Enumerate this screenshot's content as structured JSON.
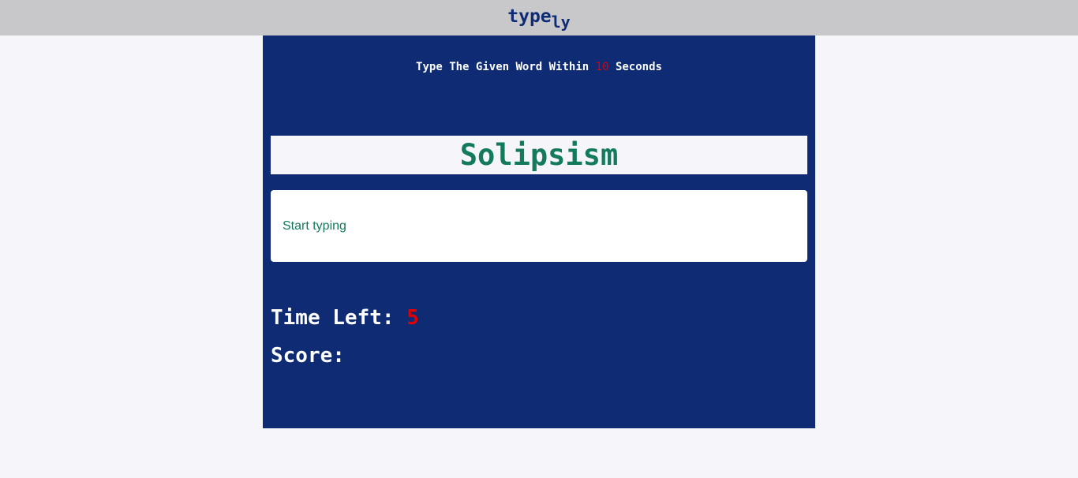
{
  "header": {
    "logo_main": "type",
    "logo_sub": "ly"
  },
  "game": {
    "instruction_prefix": "Type The Given Word Within",
    "instruction_seconds": "10",
    "instruction_suffix": "Seconds",
    "current_word": "Solipsism",
    "input": {
      "value": "",
      "placeholder": "Start typing"
    },
    "time_left_label": "Time Left:",
    "time_left_value": "5",
    "score_label": "Score:",
    "score_value": ""
  },
  "colors": {
    "header_bg": "#c8c8cb",
    "panel_bg": "#0e2b74",
    "word_color": "#137a5e",
    "accent_red": "#e00000",
    "page_bg": "#f5f5fa"
  }
}
